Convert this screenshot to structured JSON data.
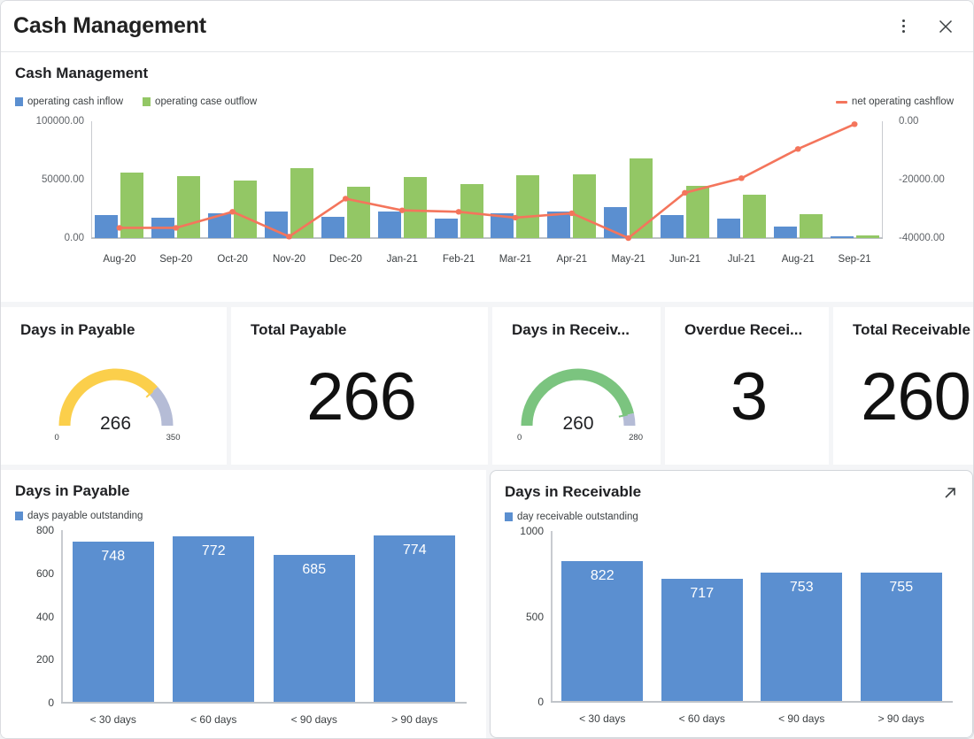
{
  "window": {
    "title": "Cash Management",
    "menu_icon": "kebab-menu-icon",
    "close_icon": "close-icon"
  },
  "colors": {
    "inflow": "#5b8fd0",
    "outflow": "#93c765",
    "netline": "#f4755c",
    "gauge_payable": "#fbcf4b",
    "gauge_receivable": "#7bc47f",
    "gauge_track": "#b5bcd6",
    "bar_blue": "#5b8fd0"
  },
  "main_panel": {
    "title": "Cash Management",
    "legend_left": [
      {
        "label": "operating cash inflow",
        "marker": "square",
        "color": "#5b8fd0"
      },
      {
        "label": "operating case outflow",
        "marker": "square",
        "color": "#93c765"
      }
    ],
    "legend_right": [
      {
        "label": "net operating cashflow",
        "marker": "line",
        "color": "#f4755c"
      }
    ]
  },
  "kpis": [
    {
      "title": "Days in Payable",
      "type": "gauge",
      "value": "266",
      "min": "0",
      "max": "350",
      "percent": 76,
      "color": "#fbcf4b"
    },
    {
      "title": "Total Payable",
      "type": "number",
      "value": "266"
    },
    {
      "title": "Days in Receiv...",
      "type": "gauge",
      "value": "260",
      "min": "0",
      "max": "280",
      "percent": 93,
      "color": "#7bc47f"
    },
    {
      "title": "Overdue Recei...",
      "type": "number",
      "value": "3"
    },
    {
      "title": "Total Receivable",
      "type": "number",
      "value": "260"
    }
  ],
  "bottom_panels": [
    {
      "title": "Days in Payable",
      "legend_label": "days payable outstanding",
      "selected": false,
      "expand_icon": null
    },
    {
      "title": "Days in Receivable",
      "legend_label": "day receivable outstanding",
      "selected": true,
      "expand_icon": "expand-arrow-icon"
    }
  ],
  "chart_data": [
    {
      "type": "bar",
      "id": "cash-management-combo",
      "title": "Cash Management",
      "categories": [
        "Aug-20",
        "Sep-20",
        "Oct-20",
        "Nov-20",
        "Dec-20",
        "Jan-21",
        "Feb-21",
        "Mar-21",
        "Apr-21",
        "May-21",
        "Jun-21",
        "Jul-21",
        "Aug-21",
        "Sep-21"
      ],
      "series": [
        {
          "name": "operating cash inflow",
          "type": "bar",
          "axis": "left",
          "values": [
            19500,
            17500,
            21500,
            22500,
            18500,
            23000,
            16500,
            21000,
            23000,
            26500,
            19500,
            17000,
            9500,
            800
          ]
        },
        {
          "name": "operating case outflow",
          "type": "bar",
          "axis": "left",
          "values": [
            56000,
            53000,
            49500,
            60000,
            44000,
            52000,
            46500,
            54000,
            54500,
            68000,
            44500,
            37500,
            20500,
            2500
          ]
        },
        {
          "name": "net operating cashflow",
          "type": "line",
          "axis": "right",
          "values": [
            -36500,
            -36500,
            -31000,
            -39500,
            -26500,
            -30500,
            -31000,
            -33000,
            -31500,
            -40000,
            -24500,
            -19500,
            -9500,
            -1000
          ]
        }
      ],
      "xlabel": "",
      "ylabel_left": "",
      "ylabel_right": "",
      "ylim_left": [
        0,
        100000
      ],
      "ylim_right": [
        -40000,
        0
      ],
      "yticks_left": [
        "0.00",
        "50000.00",
        "100000.00"
      ],
      "yticks_right": [
        "-40000.00",
        "-20000.00",
        "0.00"
      ],
      "grid": false,
      "legend_position": "top"
    },
    {
      "type": "bar",
      "id": "days-in-payable",
      "title": "Days in Payable",
      "categories": [
        "< 30 days",
        "< 60 days",
        "< 90 days",
        "> 90 days"
      ],
      "values": [
        748,
        772,
        685,
        774
      ],
      "series": [
        {
          "name": "days payable outstanding",
          "values": [
            748,
            772,
            685,
            774
          ]
        }
      ],
      "xlabel": "",
      "ylabel": "",
      "ylim": [
        0,
        800
      ],
      "yticks": [
        "0",
        "200",
        "400",
        "600",
        "800"
      ],
      "grid": false,
      "legend_position": "top"
    },
    {
      "type": "bar",
      "id": "days-in-receivable",
      "title": "Days in Receivable",
      "categories": [
        "< 30 days",
        "< 60 days",
        "< 90 days",
        "> 90 days"
      ],
      "values": [
        822,
        717,
        753,
        755
      ],
      "series": [
        {
          "name": "day receivable outstanding",
          "values": [
            822,
            717,
            753,
            755
          ]
        }
      ],
      "xlabel": "",
      "ylabel": "",
      "ylim": [
        0,
        1000
      ],
      "yticks": [
        "0",
        "500",
        "1000"
      ],
      "grid": false,
      "legend_position": "top"
    }
  ]
}
